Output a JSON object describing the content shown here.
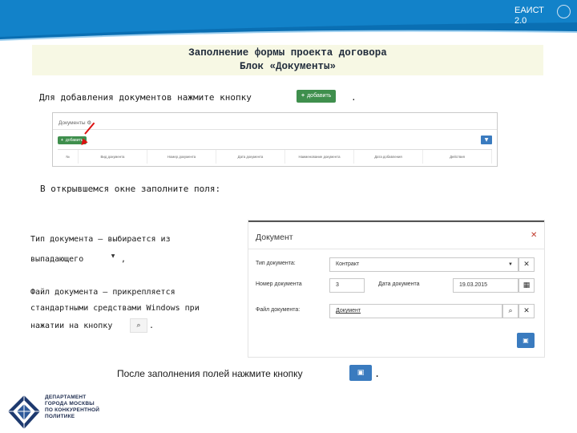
{
  "header": {
    "brand_line1": "ЕАИСТ",
    "brand_line2": "2.0"
  },
  "title": {
    "line1": "Заполнение формы проекта договора",
    "line2": "Блок «Документы»"
  },
  "intro": {
    "text": "Для добавления документов нажмите кнопку",
    "button_label": "добавить",
    "period": "."
  },
  "documents_panel": {
    "title": "Документы",
    "add_label": "добавить",
    "columns": [
      "№",
      "Вид документа",
      "Номер документа",
      "Дата документа",
      "Наименование документа",
      "Дата добавления",
      "Действия"
    ]
  },
  "fill_text": "В открывшемся окне заполните поля:",
  "type_note": {
    "line1": "Тип документа – выбирается из",
    "line2": "выпадающего",
    "tail": ","
  },
  "file_note": {
    "line1": "Файл документа – прикрепляется",
    "line2": "стандартными средствами Windows при",
    "line3": "нажатии на кнопку",
    "tail": "."
  },
  "dialog": {
    "title": "Документ",
    "type_label": "Тип документа:",
    "type_value": "Контракт",
    "number_label": "Номер документа",
    "number_value": "3",
    "date_label": "Дата документа",
    "date_value": "19.03.2015",
    "file_label": "Файл документа:",
    "file_value": "Документ"
  },
  "after_fill": {
    "text": "После заполнения полей нажмите кнопку",
    "period": "."
  },
  "logo": {
    "line1": "ДЕПАРТАМЕНТ",
    "line2": "ГОРОДА МОСКВЫ",
    "line3": "ПО КОНКУРЕНТНОЙ",
    "line4": "ПОЛИТИКЕ"
  },
  "colors": {
    "header_blue": "#0a6fb3",
    "green_button": "#3f8f4d",
    "blue_button": "#3a7bbf",
    "title_bg": "#f7f8e4"
  }
}
